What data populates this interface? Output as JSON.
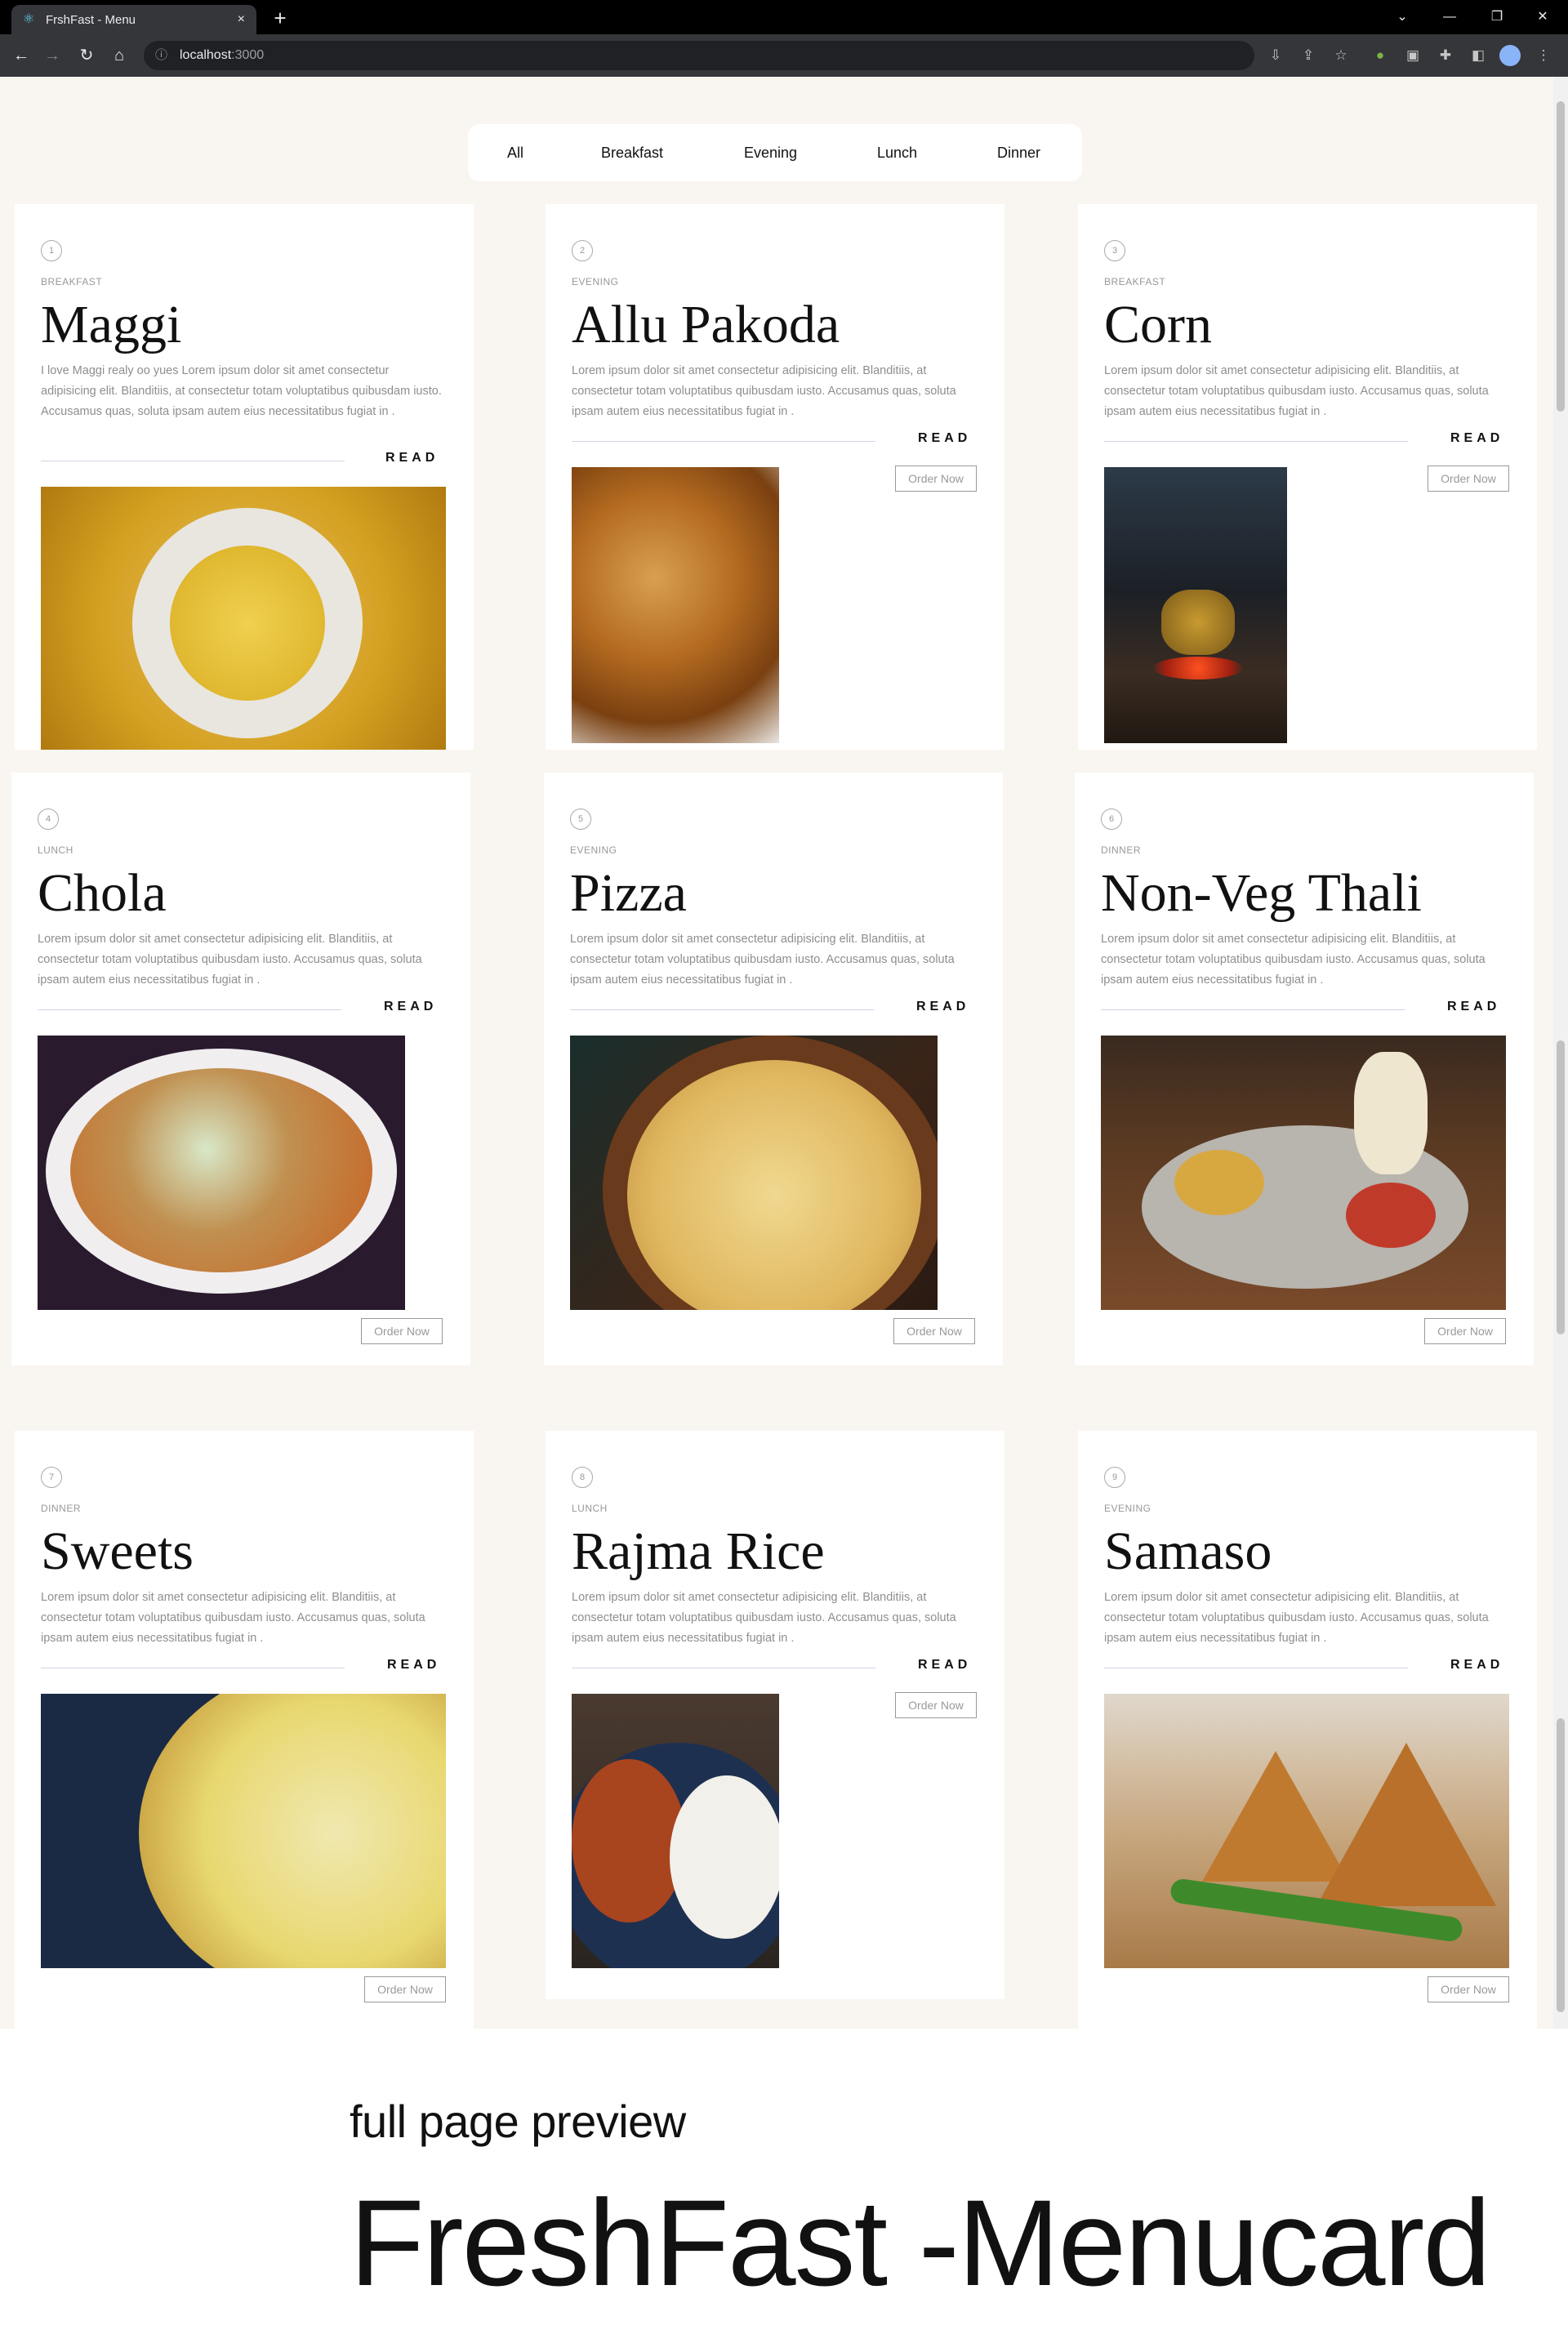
{
  "browser": {
    "tab_title": "FrshFast - Menu",
    "tab_close": "×",
    "new_tab": "+",
    "url_host": "localhost",
    "url_port": ":3000",
    "window_controls": [
      "⌄",
      "—",
      "❐",
      "✕"
    ]
  },
  "filters": [
    "All",
    "Breakfast",
    "Evening",
    "Lunch",
    "Dinner"
  ],
  "read_label": "READ",
  "order_label": "Order Now",
  "items": [
    {
      "num": "1",
      "category": "BREAKFAST",
      "title": "Maggi",
      "description": "I love Maggi realy oo yues Lorem ipsum dolor sit amet consectetur adipisicing elit. Blanditiis, at consectetur totam voluptatibus quibusdam iusto. Accusamus quas, soluta ipsam autem eius necessitatibus fugiat in ."
    },
    {
      "num": "2",
      "category": "EVENING",
      "title": "Allu Pakoda",
      "description": "Lorem ipsum dolor sit amet consectetur adipisicing elit. Blanditiis, at consectetur totam voluptatibus quibusdam iusto. Accusamus quas, soluta ipsam autem eius necessitatibus fugiat in ."
    },
    {
      "num": "3",
      "category": "BREAKFAST",
      "title": "Corn",
      "description": "Lorem ipsum dolor sit amet consectetur adipisicing elit. Blanditiis, at consectetur totam voluptatibus quibusdam iusto. Accusamus quas, soluta ipsam autem eius necessitatibus fugiat in ."
    },
    {
      "num": "4",
      "category": "LUNCH",
      "title": "Chola",
      "description": "Lorem ipsum dolor sit amet consectetur adipisicing elit. Blanditiis, at consectetur totam voluptatibus quibusdam iusto. Accusamus quas, soluta ipsam autem eius necessitatibus fugiat in ."
    },
    {
      "num": "5",
      "category": "EVENING",
      "title": "Pizza",
      "description": "Lorem ipsum dolor sit amet consectetur adipisicing elit. Blanditiis, at consectetur totam voluptatibus quibusdam iusto. Accusamus quas, soluta ipsam autem eius necessitatibus fugiat in ."
    },
    {
      "num": "6",
      "category": "DINNER",
      "title": "Non-Veg Thali",
      "description": "Lorem ipsum dolor sit amet consectetur adipisicing elit. Blanditiis, at consectetur totam voluptatibus quibusdam iusto. Accusamus quas, soluta ipsam autem eius necessitatibus fugiat in ."
    },
    {
      "num": "7",
      "category": "DINNER",
      "title": "Sweets",
      "description": "Lorem ipsum dolor sit amet consectetur adipisicing elit. Blanditiis, at consectetur totam voluptatibus quibusdam iusto. Accusamus quas, soluta ipsam autem eius necessitatibus fugiat in ."
    },
    {
      "num": "8",
      "category": "LUNCH",
      "title": "Rajma Rice",
      "description": "Lorem ipsum dolor sit amet consectetur adipisicing elit. Blanditiis, at consectetur totam voluptatibus quibusdam iusto. Accusamus quas, soluta ipsam autem eius necessitatibus fugiat in ."
    },
    {
      "num": "9",
      "category": "EVENING",
      "title": "Samaso",
      "description": "Lorem ipsum dolor sit amet consectetur adipisicing elit. Blanditiis, at consectetur totam voluptatibus quibusdam iusto. Accusamus quas, soluta ipsam autem eius necessitatibus fugiat in ."
    }
  ],
  "caption": {
    "line1": "full page preview",
    "line2": "FreshFast -Menucard"
  },
  "colors": {
    "page_bg": "#f9f6f1",
    "card_bg": "#ffffff",
    "rule": "#d6d3e5"
  }
}
